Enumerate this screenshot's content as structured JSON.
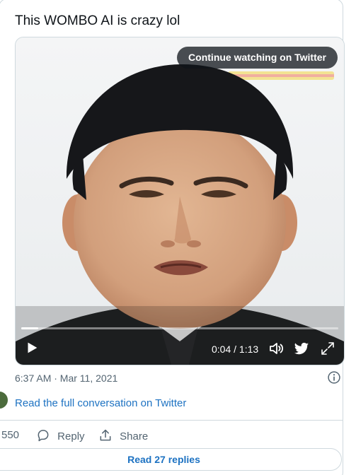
{
  "tweet": {
    "text": "This WOMBO AI is crazy lol",
    "timestamp": "6:37 AM · Mar 11, 2021"
  },
  "video": {
    "continue_label": "Continue watching on Twitter",
    "time_display": "0:04 / 1:13",
    "progress_fraction": 0.054
  },
  "conversation": {
    "read_full_label": "Read the full conversation on Twitter"
  },
  "actions": {
    "likes_count": "550",
    "reply_label": "Reply",
    "share_label": "Share",
    "read_replies_label": "Read 27 replies"
  },
  "colors": {
    "link": "#1d72c2",
    "secondary_text": "#536471",
    "border": "#cfd9de"
  },
  "icons": [
    "play-icon",
    "volume-icon",
    "twitter-bird-icon",
    "expand-icon",
    "info-icon",
    "reply-icon",
    "share-icon"
  ]
}
